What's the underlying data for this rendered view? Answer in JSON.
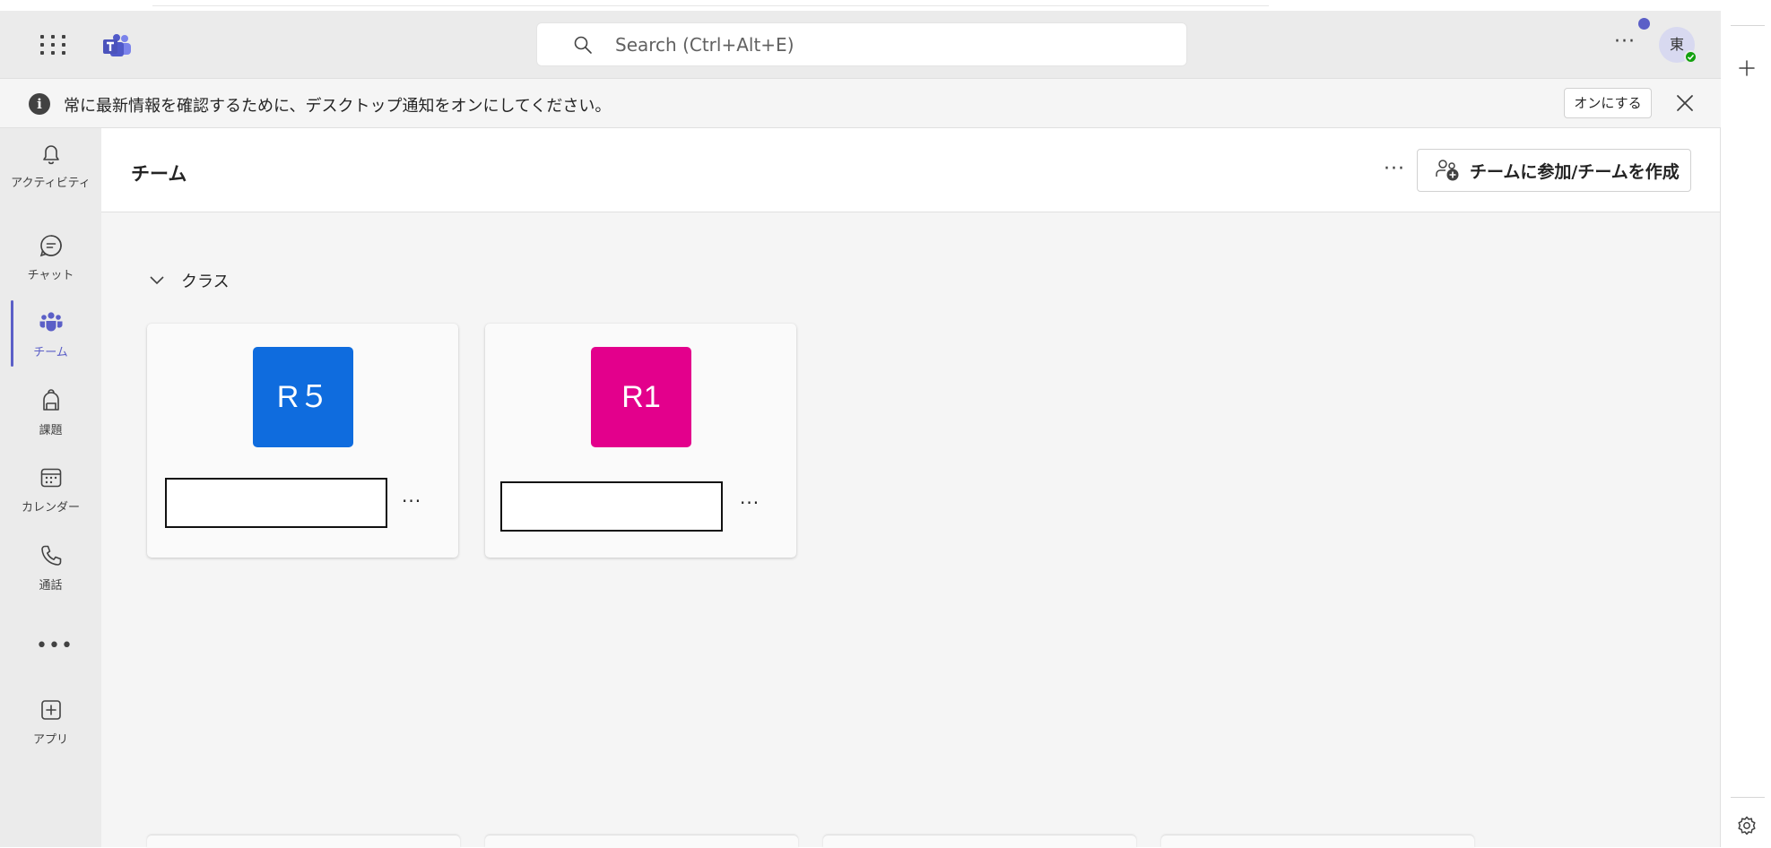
{
  "topbar": {
    "search_placeholder": "Search (Ctrl+Alt+E)",
    "more_label": "···",
    "avatar_initial": "東"
  },
  "banner": {
    "message": "常に最新情報を確認するために、デスクトップ通知をオンにしてください。",
    "enable_label": "オンにする"
  },
  "rail": {
    "items": [
      {
        "label": "アクティビティ",
        "icon": "bell-icon"
      },
      {
        "label": "チャット",
        "icon": "chat-icon"
      },
      {
        "label": "チーム",
        "icon": "teams-icon"
      },
      {
        "label": "課題",
        "icon": "backpack-icon"
      },
      {
        "label": "カレンダー",
        "icon": "calendar-icon"
      },
      {
        "label": "通話",
        "icon": "phone-icon"
      },
      {
        "label": "アプリ",
        "icon": "add-app-icon"
      }
    ],
    "more_label": "•••"
  },
  "main": {
    "title": "チーム",
    "more_label": "···",
    "join_button_label": "チームに参加/チームを作成",
    "section_label": "クラス",
    "teams": [
      {
        "tile_text": "R５",
        "tile_color": "#0f6cde"
      },
      {
        "tile_text": "R1",
        "tile_color": "#e3008c"
      }
    ],
    "card_more_label": "···"
  },
  "colors": {
    "accent": "#5b5fc7",
    "presence": "#13a10e"
  }
}
